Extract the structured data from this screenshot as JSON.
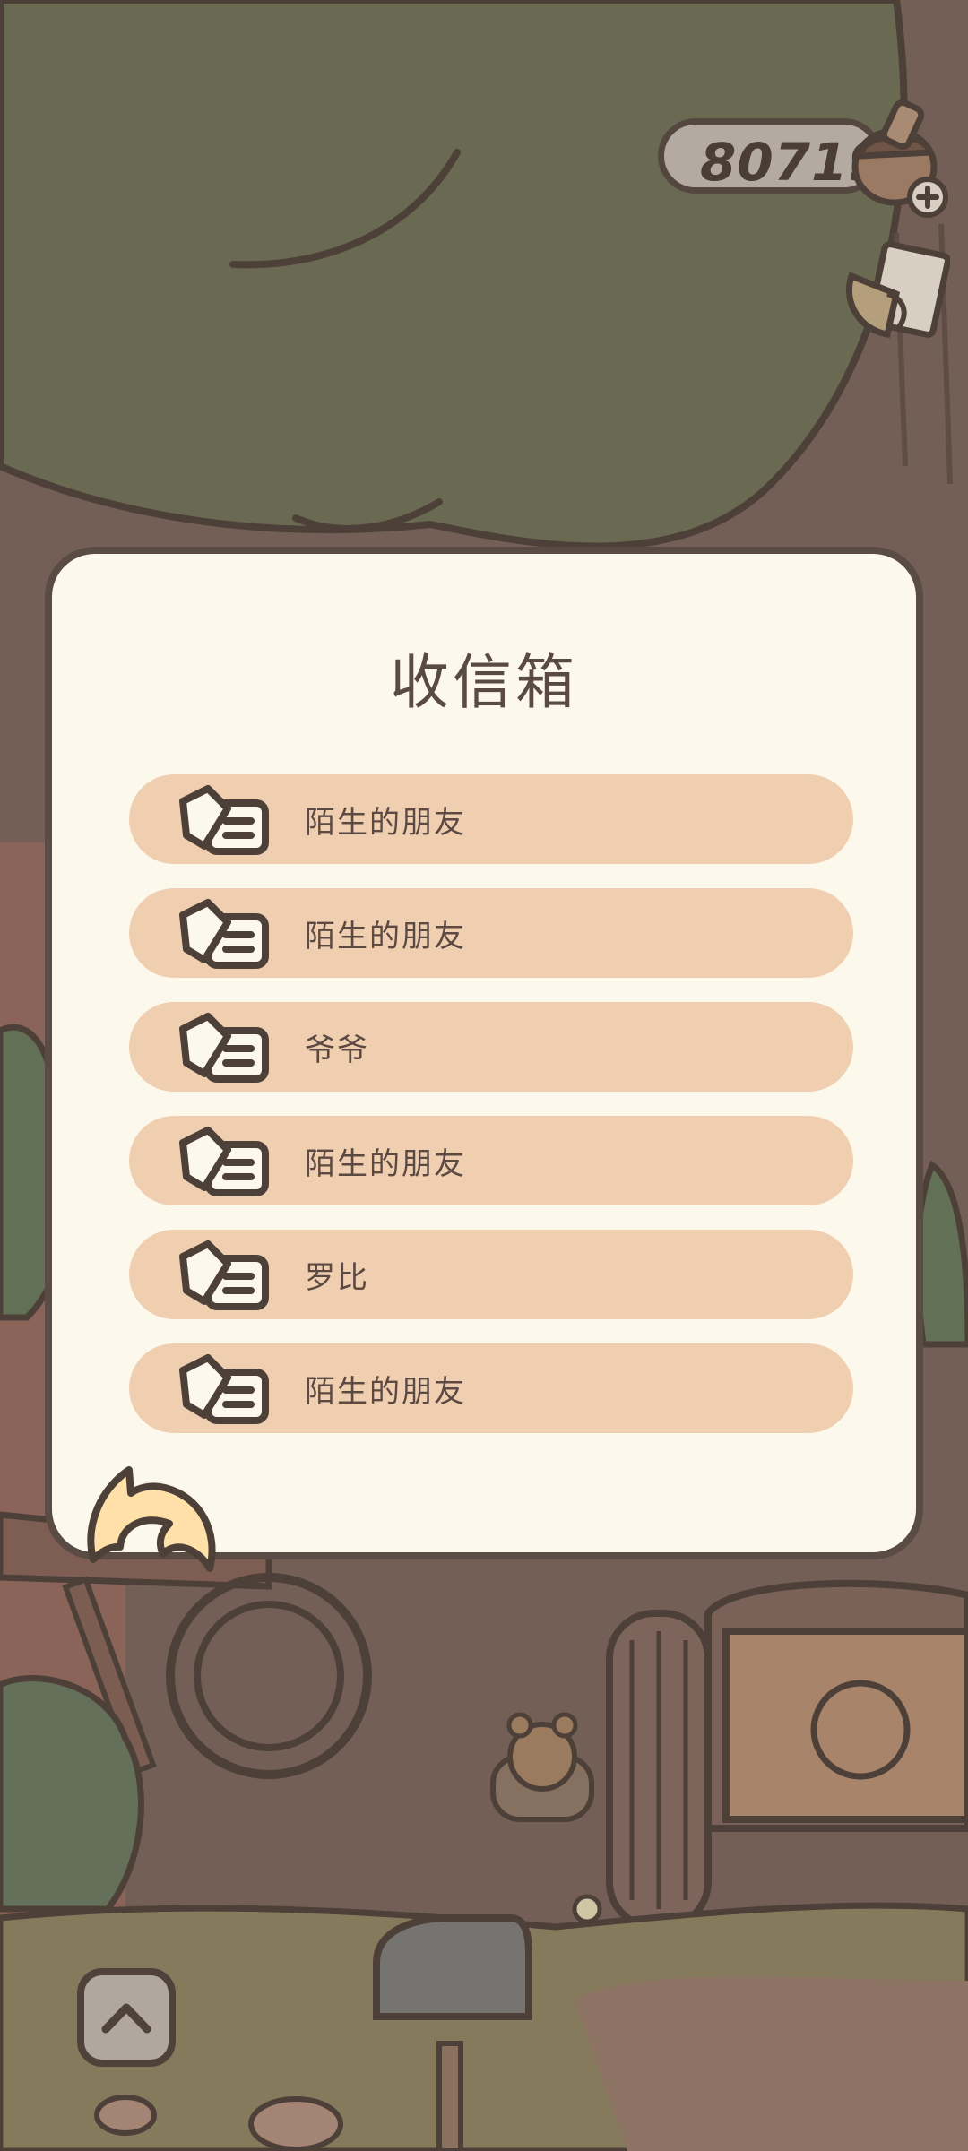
{
  "header": {
    "coin_count": "80719",
    "coin_icon": "acorn-icon",
    "add_icon": "plus-icon",
    "mail_shortcut_icon": "mail-note-icon"
  },
  "inbox": {
    "title": "收信箱",
    "items": [
      {
        "sender": "陌生的朋友",
        "icon": "envelope-icon"
      },
      {
        "sender": "陌生的朋友",
        "icon": "envelope-icon"
      },
      {
        "sender": "爷爷",
        "icon": "envelope-icon"
      },
      {
        "sender": "陌生的朋友",
        "icon": "envelope-icon"
      },
      {
        "sender": "罗比",
        "icon": "envelope-icon"
      },
      {
        "sender": "陌生的朋友",
        "icon": "envelope-icon"
      }
    ],
    "back_icon": "curved-back-arrow-icon"
  },
  "bottom": {
    "expand_icon": "chevron-up-icon"
  },
  "colors": {
    "dialog_bg": "#fdf8ec",
    "item_bg": "#efcfb0",
    "outline": "#5a4b44",
    "text": "#5c4a42",
    "back_arrow": "#ffe0a8"
  }
}
